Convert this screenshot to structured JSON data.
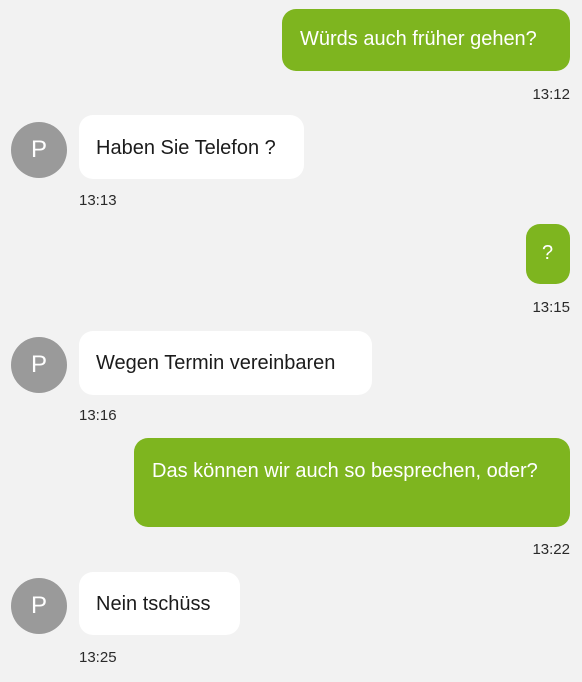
{
  "messages": [
    {
      "direction": "outgoing",
      "text": "Würds auch früher gehen?",
      "time": "13:12"
    },
    {
      "direction": "incoming",
      "avatar": "P",
      "text": "Haben Sie Telefon ?",
      "time": "13:13"
    },
    {
      "direction": "outgoing",
      "text": "?",
      "time": "13:15"
    },
    {
      "direction": "incoming",
      "avatar": "P",
      "text": "Wegen Termin vereinbaren",
      "time": "13:16"
    },
    {
      "direction": "outgoing",
      "text": "Das können wir auch so besprechen, oder?",
      "time": "13:22"
    },
    {
      "direction": "incoming",
      "avatar": "P",
      "text": "Nein tschüss",
      "time": "13:25"
    }
  ],
  "colors": {
    "outgoing_bubble": "#7eb51f",
    "incoming_bubble": "#ffffff",
    "avatar": "#9a9a9a",
    "background": "#f2f2f2"
  }
}
